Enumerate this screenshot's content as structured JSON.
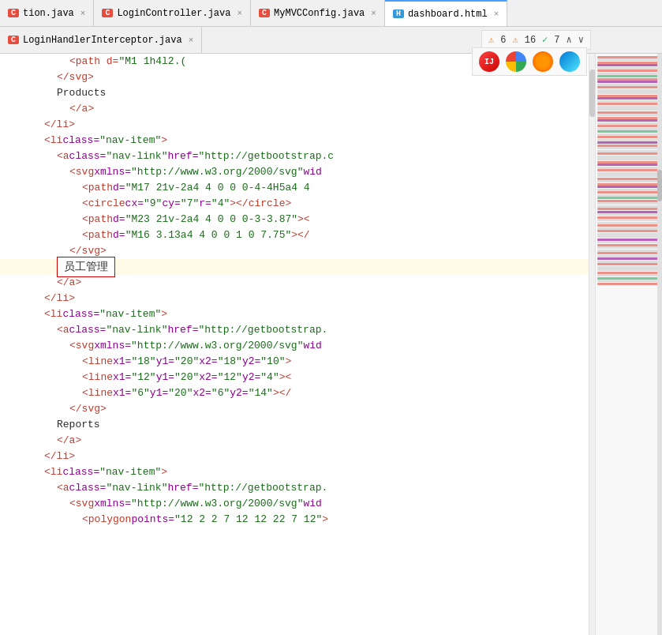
{
  "tabs": {
    "row1": [
      {
        "id": "tab-action",
        "icon": "c",
        "label": "tion.java",
        "active": false,
        "closable": true
      },
      {
        "id": "tab-login-controller",
        "icon": "c",
        "label": "LoginController.java",
        "active": false,
        "closable": true
      },
      {
        "id": "tab-mymvcconfig",
        "icon": "c",
        "label": "MyMVCConfig.java",
        "active": false,
        "closable": true
      },
      {
        "id": "tab-dashboard",
        "icon": "h",
        "label": "dashboard.html",
        "active": true,
        "closable": true
      }
    ],
    "row2": [
      {
        "id": "tab-login-interceptor",
        "icon": "c",
        "label": "LoginHandlerInterceptor.java",
        "active": false,
        "closable": true
      }
    ]
  },
  "notification": {
    "warn1_icon": "⚠",
    "warn1_count": "6",
    "warn2_icon": "⚠",
    "warn2_count": "16",
    "ok_icon": "✓",
    "ok_count": "7",
    "up_icon": "^",
    "down_icon": "v"
  },
  "browsers": [
    {
      "name": "intellij",
      "color": "#e74c3c",
      "symbol": "🔴"
    },
    {
      "name": "chrome",
      "color": "#4285f4",
      "symbol": "⚪"
    },
    {
      "name": "firefox",
      "color": "#ff6600",
      "symbol": "🟠"
    },
    {
      "name": "edge",
      "color": "#0078d4",
      "symbol": "🔵"
    }
  ],
  "tooltip": {
    "text": "员工管理"
  },
  "code_lines": [
    {
      "indent": 5,
      "content": "<path d=\"M1 1h4l2.(",
      "type": "mixed",
      "highlight": ""
    },
    {
      "indent": 4,
      "content": "</svg>",
      "type": "tag",
      "highlight": ""
    },
    {
      "indent": 4,
      "content": "Products",
      "type": "text",
      "highlight": ""
    },
    {
      "indent": 5,
      "content": "</a>",
      "type": "tag",
      "highlight": ""
    },
    {
      "indent": 3,
      "content": "</li>",
      "type": "tag",
      "highlight": ""
    },
    {
      "indent": 3,
      "content": "<li class=\"nav-item\">",
      "type": "tag",
      "highlight": ""
    },
    {
      "indent": 4,
      "content": "<a class=\"nav-link\" href=\"http://getbootstrap.c",
      "type": "tag",
      "highlight": ""
    },
    {
      "indent": 5,
      "content": "<svg xmlns=\"http://www.w3.org/2000/svg\" wid",
      "type": "tag",
      "highlight": ""
    },
    {
      "indent": 6,
      "content": "<path d=\"M17 21v-2a4 4 0 0 0-4-4H5a4 4",
      "type": "tag",
      "highlight": ""
    },
    {
      "indent": 6,
      "content": "<circle cx=\"9\" cy=\"7\" r=\"4\"></circle>",
      "type": "tag",
      "highlight": ""
    },
    {
      "indent": 6,
      "content": "<path d=\"M23 21v-2a4 4 0 0 0-3-3.87\">",
      "type": "tag",
      "highlight": ""
    },
    {
      "indent": 6,
      "content": "<path d=\"M16 3.13a4 4 0 0 1 0 7.75\"></",
      "type": "tag",
      "highlight": ""
    },
    {
      "indent": 5,
      "content": "</svg>",
      "type": "tag",
      "highlight": ""
    },
    {
      "indent": 4,
      "content": "TOOLTIP_PLACEHOLDER",
      "type": "tooltip",
      "highlight": "yellow"
    },
    {
      "indent": 4,
      "content": "</a>",
      "type": "tag",
      "highlight": ""
    },
    {
      "indent": 3,
      "content": "</li>",
      "type": "tag",
      "highlight": ""
    },
    {
      "indent": 3,
      "content": "<li class=\"nav-item\">",
      "type": "tag",
      "highlight": ""
    },
    {
      "indent": 4,
      "content": "<a class=\"nav-link\" href=\"http://getbootstrap.",
      "type": "tag",
      "highlight": ""
    },
    {
      "indent": 5,
      "content": "<svg xmlns=\"http://www.w3.org/2000/svg\" wid",
      "type": "tag",
      "highlight": ""
    },
    {
      "indent": 6,
      "content": "<line x1=\"18\" y1=\"20\" x2=\"18\" y2=\"10\">",
      "type": "tag",
      "highlight": ""
    },
    {
      "indent": 6,
      "content": "<line x1=\"12\" y1=\"20\" x2=\"12\" y2=\"4\"><",
      "type": "tag",
      "highlight": ""
    },
    {
      "indent": 6,
      "content": "<line x1=\"6\" y1=\"20\" x2=\"6\" y2=\"14\"></",
      "type": "tag",
      "highlight": ""
    },
    {
      "indent": 5,
      "content": "</svg>",
      "type": "tag",
      "highlight": ""
    },
    {
      "indent": 4,
      "content": "Reports",
      "type": "text",
      "highlight": ""
    },
    {
      "indent": 4,
      "content": "</a>",
      "type": "tag",
      "highlight": ""
    },
    {
      "indent": 3,
      "content": "</li>",
      "type": "tag",
      "highlight": ""
    },
    {
      "indent": 3,
      "content": "<li class=\"nav-item\">",
      "type": "tag",
      "highlight": ""
    },
    {
      "indent": 4,
      "content": "<a class=\"nav-link\" href=\"http://getbootstrap.",
      "type": "tag",
      "highlight": ""
    },
    {
      "indent": 5,
      "content": "<svg xmlns=\"http://www.w3.org/2000/svg\" wid",
      "type": "tag",
      "highlight": ""
    },
    {
      "indent": 6,
      "content": "<polygon points=\"12 2 2 7 12 12 22 7 12\">",
      "type": "tag",
      "highlight": ""
    }
  ],
  "colors": {
    "tag": "#c0392b",
    "attr": "#8b008b",
    "val": "#1a6b1a",
    "text": "#2c2c2c",
    "highlight_yellow": "#fffbe6",
    "tab_active_bg": "#ffffff",
    "tab_inactive_bg": "#f0f0f0"
  }
}
